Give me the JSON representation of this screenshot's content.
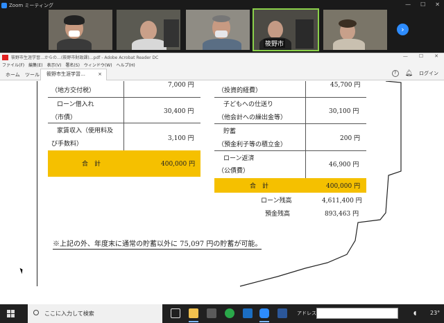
{
  "zoom": {
    "window_title": "Zoom ミーティング",
    "participant_name": "筱野市",
    "next_page_icon": "chevron-right-icon"
  },
  "acrobat": {
    "window_title": "筱野市生涯学習…からの…(筱野市財政課)…pdf - Adobe Acrobat Reader DC",
    "menu": [
      "ファイル(F)",
      "編集(E)",
      "表示(V)",
      "署名(S)",
      "ウィンドウ(W)",
      "ヘルプ(H)"
    ],
    "tabs": {
      "home": "ホーム",
      "tools": "ツール",
      "document": "筱野市生涯学習…",
      "close": "×"
    },
    "login": "ログイン"
  },
  "document": {
    "left_rows": [
      {
        "label": "（地方交付税）",
        "amount": "7,000 円"
      },
      {
        "label": "ローン借入れ",
        "label2": "（市債）",
        "amount": "30,400 円"
      },
      {
        "label": "家賃収入（使用料及",
        "label2": "び手数料）",
        "amount": "3,100 円"
      }
    ],
    "left_total": {
      "label": "合　計",
      "amount": "400,000 円"
    },
    "right_rows": [
      {
        "label": "（投資的経費）",
        "amount": "45,700 円"
      },
      {
        "label": "子どもへの仕送り",
        "label2": "（他会計への繰出金等）",
        "amount": "30,100 円"
      },
      {
        "label": "貯蓄",
        "label2": "（預金利子等の積立金）",
        "amount": "200 円"
      },
      {
        "label": "ローン返済",
        "label2": "（公債費）",
        "amount": "46,900 円"
      }
    ],
    "right_total": {
      "label": "合　計",
      "amount": "400,000 円"
    },
    "balances": [
      {
        "label": "ローン残高",
        "amount": "4,611,400 円"
      },
      {
        "label": "預金残高",
        "amount": "893,463 円"
      }
    ],
    "note": "※上記の外、年度末に通常の貯蓄以外に 75,097 円の貯蓄が可能。",
    "total_color": "#f5c000"
  },
  "taskbar": {
    "search_placeholder": "ここに入力して検索",
    "address_label": "アドレス",
    "temperature": "23°"
  }
}
